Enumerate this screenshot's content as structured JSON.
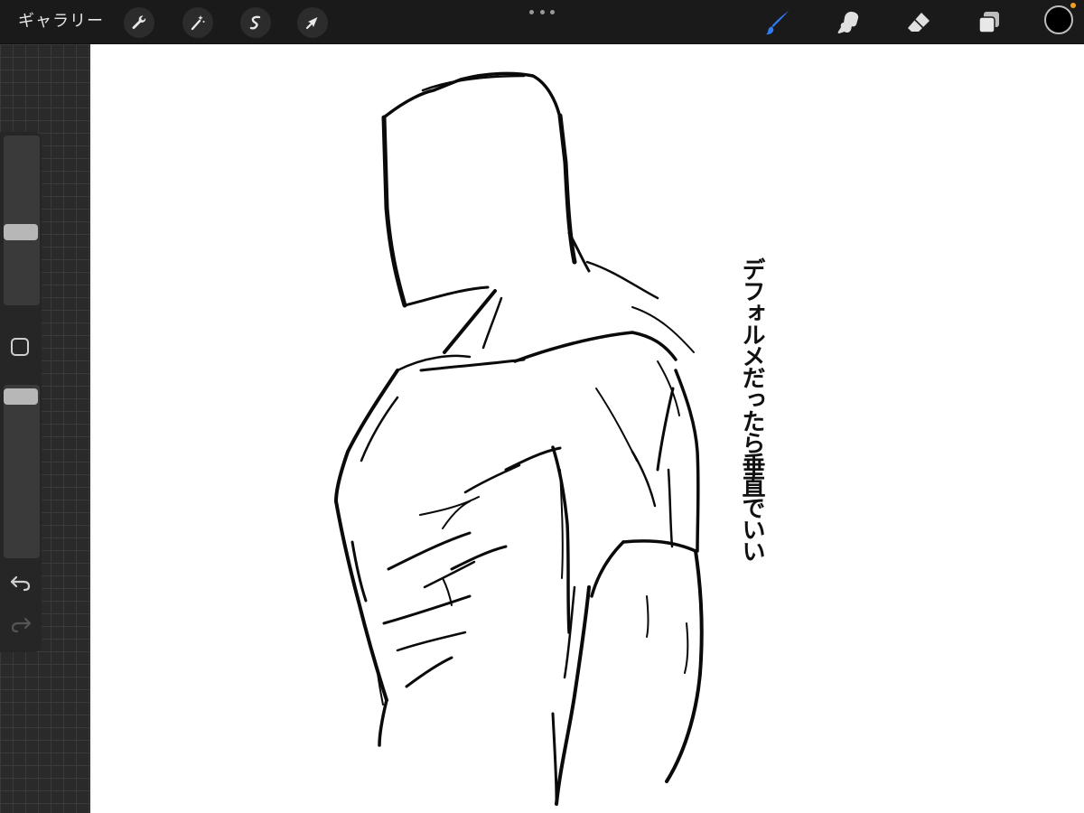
{
  "toolbar": {
    "gallery_label": "ギャラリー",
    "left_tools": [
      "wrench-icon",
      "magic-wand-icon",
      "selection-icon",
      "transform-arrow-icon"
    ],
    "right_tools": [
      "brush-icon",
      "smudge-icon",
      "eraser-icon",
      "layers-icon"
    ],
    "active_tool": "brush",
    "accent_color": "#2f7df6",
    "current_color": "#000000"
  },
  "sidebar": {
    "brush_size_level": 0.6,
    "opacity_level": 0.95,
    "modify_icon": "square-icon",
    "undo_icon": "undo-arrow-icon",
    "redo_icon": "redo-arrow-icon"
  },
  "canvas": {
    "note_text": "デフォルメだったら垂直でいい"
  }
}
